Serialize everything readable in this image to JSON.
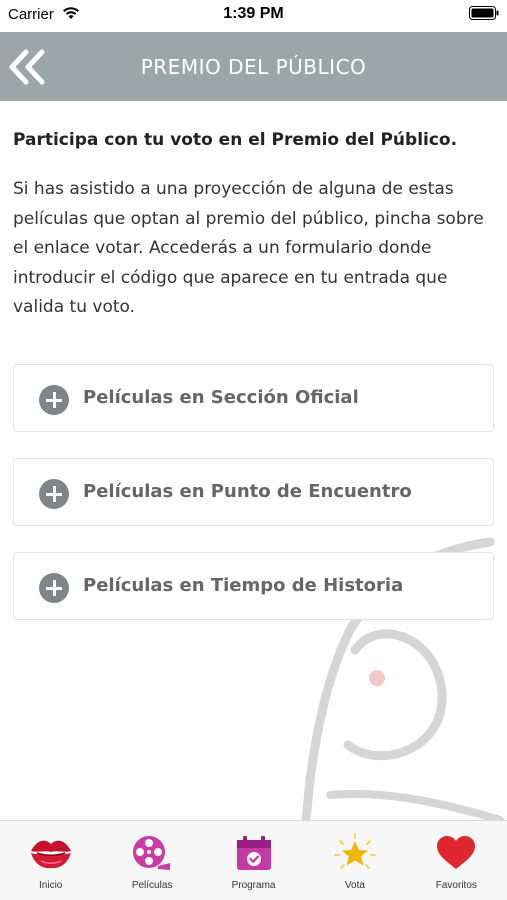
{
  "status_bar": {
    "carrier": "Carrier",
    "time": "1:39 PM"
  },
  "header": {
    "title": "PREMIO DEL PÚBLICO",
    "back_icon": "double-chevron-left-icon",
    "background_color": "#9ca5a8"
  },
  "content": {
    "heading": "Participa con tu voto en el Premio del Público.",
    "body": "Si has asistido a una proyección de alguna de estas películas que optan al premio del público, pincha sobre el enlace votar. Accederás a un formulario donde introducir el código que aparece en tu entrada que valida tu voto."
  },
  "sections": [
    {
      "label": "Películas en Sección Oficial",
      "icon": "plus-circle-icon"
    },
    {
      "label": "Películas en Punto de Encuentro",
      "icon": "plus-circle-icon"
    },
    {
      "label": "Películas en Tiempo de Historia",
      "icon": "plus-circle-icon"
    }
  ],
  "tab_bar": {
    "tabs": [
      {
        "label": "Inicio",
        "icon": "lips-icon"
      },
      {
        "label": "Películas",
        "icon": "film-reel-icon"
      },
      {
        "label": "Programa",
        "icon": "calendar-icon"
      },
      {
        "label": "Vota",
        "icon": "star-icon"
      },
      {
        "label": "Favoritos",
        "icon": "heart-icon"
      }
    ]
  }
}
